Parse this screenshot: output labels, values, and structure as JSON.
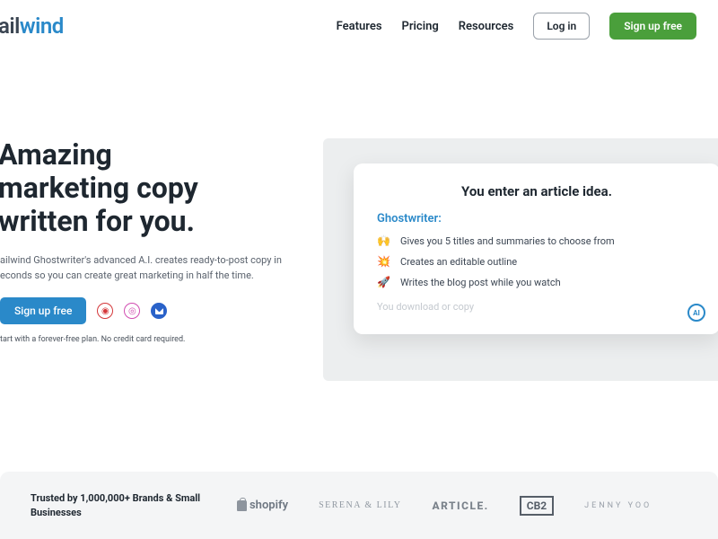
{
  "brand": {
    "part1": "ail",
    "part2": "w",
    "part3": "ind"
  },
  "nav": {
    "links": [
      "Features",
      "Pricing",
      "Resources"
    ],
    "login": "Log in",
    "signup": "Sign up free"
  },
  "hero": {
    "title_l1": "Amazing",
    "title_l2": "marketing copy",
    "title_l3": "written for you.",
    "sub": "ailwind Ghostwriter's advanced A.I. creates ready-to-post copy in econds so you can create great marketing in half the time.",
    "cta": "Sign up free",
    "fineprint": "tart with a forever-free plan. No credit card required."
  },
  "social": {
    "pinterest": "pinterest-icon",
    "instagram": "instagram-icon",
    "email": "email-icon"
  },
  "demo": {
    "heading": "You enter an article idea.",
    "writer": "Ghostwriter:",
    "items": [
      {
        "emoji": "🙌",
        "text": "Gives you 5 titles and summaries to choose from"
      },
      {
        "emoji": "💥",
        "text": "Creates an editable outline"
      },
      {
        "emoji": "🚀",
        "text": "Writes the blog post while you watch"
      }
    ],
    "faded": "You download or copy",
    "badge": "AI"
  },
  "trusted": {
    "label": "Trusted by 1,000,000+ Brands & Small Businesses",
    "partners": {
      "shopify": "shopify",
      "serena": "SERENA & LILY",
      "article": "ARTICLE.",
      "cb2": "CB2",
      "jenny": "JENNY YOO"
    }
  }
}
